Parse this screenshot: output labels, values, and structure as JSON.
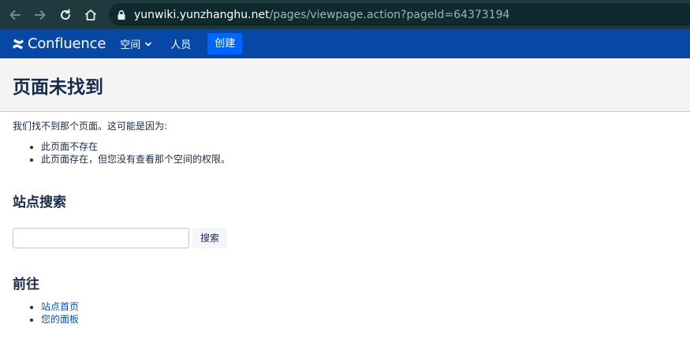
{
  "browser": {
    "url_host": "yunwiki.yunzhanghu.net",
    "url_path": "/pages/viewpage.action?pageId=64373194",
    "colors": {
      "bar": "#1f3a3f",
      "url_box": "#0f2a2e"
    }
  },
  "header": {
    "logo_text": "Confluence",
    "nav": {
      "spaces": "空间",
      "people": "人员"
    },
    "create_label": "创建",
    "colors": {
      "bar": "#0747a6",
      "create": "#0065ff"
    }
  },
  "page": {
    "title": "页面未找到",
    "intro": "我们找不到那个页面。这可能是因为:",
    "reasons": [
      "此页面不存在",
      "此页面存在，但您没有查看那个空间的权限。"
    ],
    "search_heading": "站点搜索",
    "search_input_value": "",
    "search_button": "搜索",
    "goto_heading": "前往",
    "links": [
      "站点首页",
      "您的面板"
    ]
  }
}
